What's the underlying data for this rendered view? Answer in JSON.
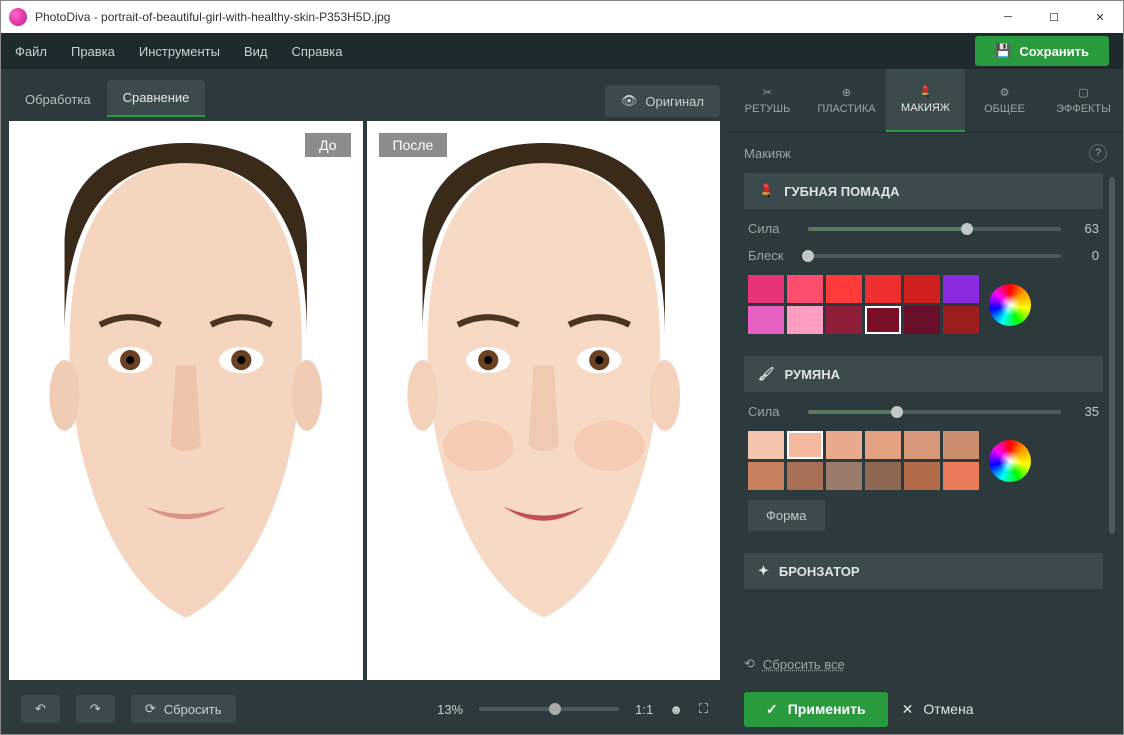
{
  "title": "PhotoDiva - portrait-of-beautiful-girl-with-healthy-skin-P353H5D.jpg",
  "menu": [
    "Файл",
    "Правка",
    "Инструменты",
    "Вид",
    "Справка"
  ],
  "save": "Сохранить",
  "viewtabs": {
    "process": "Обработка",
    "compare": "Сравнение"
  },
  "original": "Оригинал",
  "before": "До",
  "after": "После",
  "resetAll": "Сбросить",
  "zoomPercent": "13%",
  "ratio": "1:1",
  "toolcats": [
    "РЕТУШЬ",
    "ПЛАСТИКА",
    "МАКИЯЖ",
    "ОБЩЕЕ",
    "ЭФФЕКТЫ"
  ],
  "panelTitle": "Макияж",
  "lipstick": {
    "title": "ГУБНАЯ ПОМАДА",
    "strength": {
      "label": "Сила",
      "value": "63"
    },
    "gloss": {
      "label": "Блеск",
      "value": "0"
    },
    "colors": [
      "#e6337a",
      "#ff4d6d",
      "#ff3b3b",
      "#ef2f2f",
      "#d11f1f",
      "#8a2be2",
      "#e85fc4",
      "#ff9ec1",
      "#8f1d3a",
      "#7a1028",
      "#6a0f2a",
      "#9b1d1d"
    ],
    "selected": 9
  },
  "blush": {
    "title": "РУМЯНА",
    "strength": {
      "label": "Сила",
      "value": "35"
    },
    "colors": [
      "#f4c5ad",
      "#f3b89e",
      "#e8a98d",
      "#e3a181",
      "#d8997a",
      "#c98d6e",
      "#c7815f",
      "#a87054",
      "#9a7a6a",
      "#8f6854",
      "#b36b4a",
      "#e97a5a"
    ],
    "selected": 1,
    "shape": "Форма"
  },
  "bronzer": {
    "title": "БРОНЗАТОР"
  },
  "resetLink": "Сбросить все",
  "applyBtn": "Применить",
  "cancelBtn": "Отмена"
}
